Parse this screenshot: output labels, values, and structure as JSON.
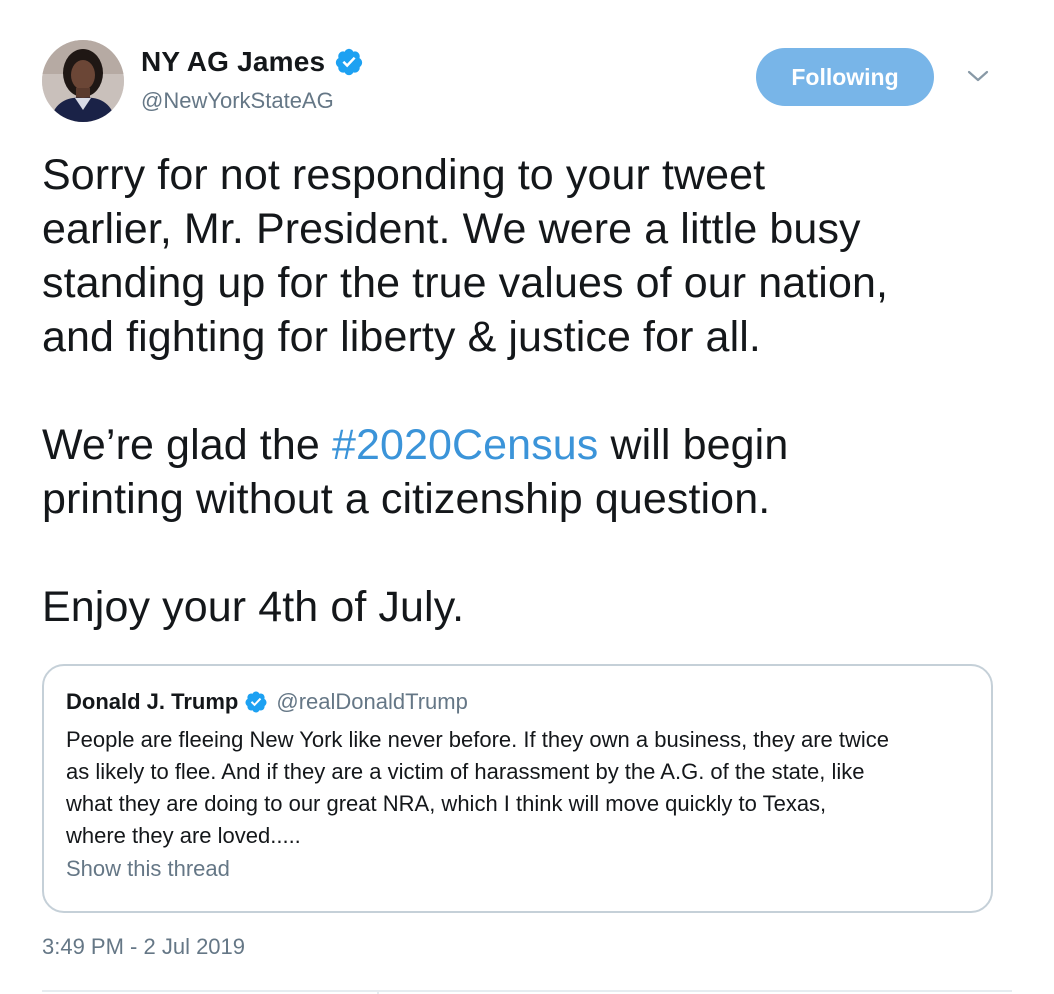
{
  "author": {
    "name": "NY AG James",
    "handle": "@NewYorkStateAG",
    "verified_icon": "verified-badge-icon",
    "avatar_icon": "avatar"
  },
  "actions": {
    "follow_label": "Following",
    "menu_icon": "chevron-down-icon"
  },
  "tweet": {
    "line1": "Sorry for not responding to your tweet",
    "line2": "earlier, Mr. President. We were a little busy",
    "line3": "standing up for the true values of our nation,",
    "line4": "and fighting for liberty & justice for all.",
    "line5_before": "We’re glad the ",
    "hashtag": "#2020Census",
    "line5_after": " will begin",
    "line6": "printing without a citizenship question.",
    "line7": "Enjoy your 4th of July."
  },
  "quoted_tweet": {
    "name": "Donald J. Trump",
    "handle": "@realDonaldTrump",
    "line1": "People are fleeing New York like never before. If they own a business, they are twice",
    "line2": "as likely to flee. And if they are a victim of harassment by the A.G. of the state, like",
    "line3": "what they are doing to our great NRA, which I think will move quickly to Texas,",
    "line4": "where they are loved.....",
    "thread_link": "Show this thread"
  },
  "timestamp": "3:49 PM - 2 Jul 2019",
  "colors": {
    "link_blue": "#3b94d9",
    "follow_button_bg": "#78b5e8",
    "secondary_text": "#657786",
    "verified_blue": "#1da1f2",
    "border": "#c5d0d8"
  }
}
